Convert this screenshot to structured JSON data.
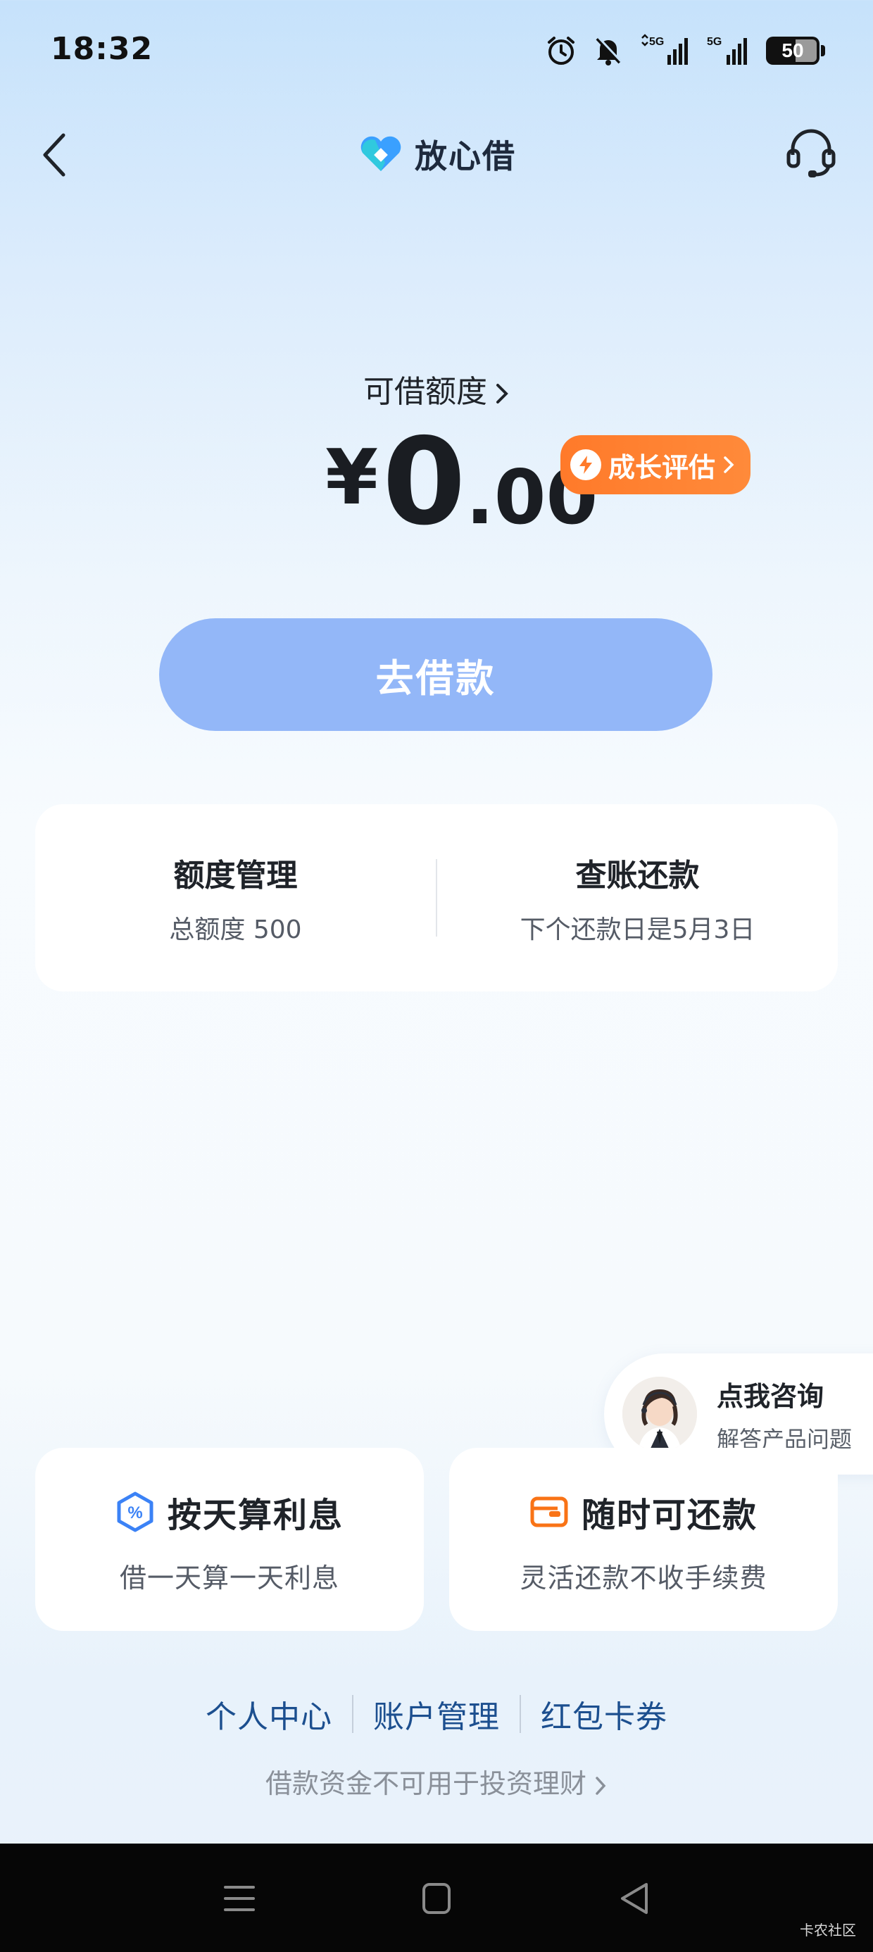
{
  "status_bar": {
    "time": "18:32",
    "network_1": "5G",
    "network_2": "5G",
    "battery": "50"
  },
  "header": {
    "brand_name": "放心借",
    "back_icon": "chevron-left-icon",
    "support_icon": "headset-icon"
  },
  "credit": {
    "label": "可借额度",
    "currency": "¥",
    "amount_integer": "0",
    "amount_decimal": ".00",
    "growth_button": "成长评估"
  },
  "borrow_button": "去借款",
  "management": {
    "quota": {
      "title": "额度管理",
      "subtitle": "总额度 500"
    },
    "repay": {
      "title": "查账还款",
      "subtitle": "下个还款日是5月3日"
    }
  },
  "consult": {
    "title": "点我咨询",
    "subtitle": "解答产品问题"
  },
  "features": [
    {
      "title": "按天算利息",
      "subtitle": "借一天算一天利息",
      "icon": "percent-shield-icon"
    },
    {
      "title": "随时可还款",
      "subtitle": "灵活还款不收手续费",
      "icon": "wallet-card-icon"
    }
  ],
  "links": [
    "个人中心",
    "账户管理",
    "红包卡券"
  ],
  "disclaimer": "借款资金不可用于投资理财",
  "watermark": "卡农社区",
  "colors": {
    "accent_orange": "#ff7a2a",
    "button_blue": "#93b7f8",
    "link_blue": "#1c4f8f",
    "brand_blue": "#3aa0ff"
  }
}
